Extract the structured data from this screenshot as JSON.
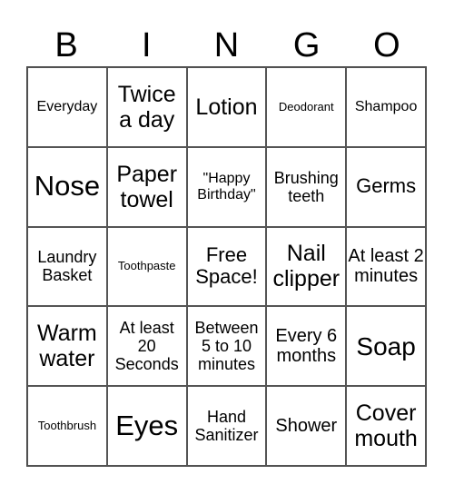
{
  "header": [
    "B",
    "I",
    "N",
    "G",
    "O"
  ],
  "cells": [
    [
      "Everyday",
      "Twice a day",
      "Lotion",
      "Deodorant",
      "Shampoo"
    ],
    [
      "Nose",
      "Paper towel",
      "\"Happy Birthday\"",
      "Brushing teeth",
      "Germs"
    ],
    [
      "Laundry Basket",
      "Toothpaste",
      "Free Space!",
      "Nail clipper",
      "At least 2 minutes"
    ],
    [
      "Warm water",
      "At least 20 Seconds",
      "Between 5 to 10 minutes",
      "Every 6 months",
      "Soap"
    ],
    [
      "Toothbrush",
      "Eyes",
      "Hand Sanitizer",
      "Shower",
      "Cover mouth"
    ]
  ]
}
